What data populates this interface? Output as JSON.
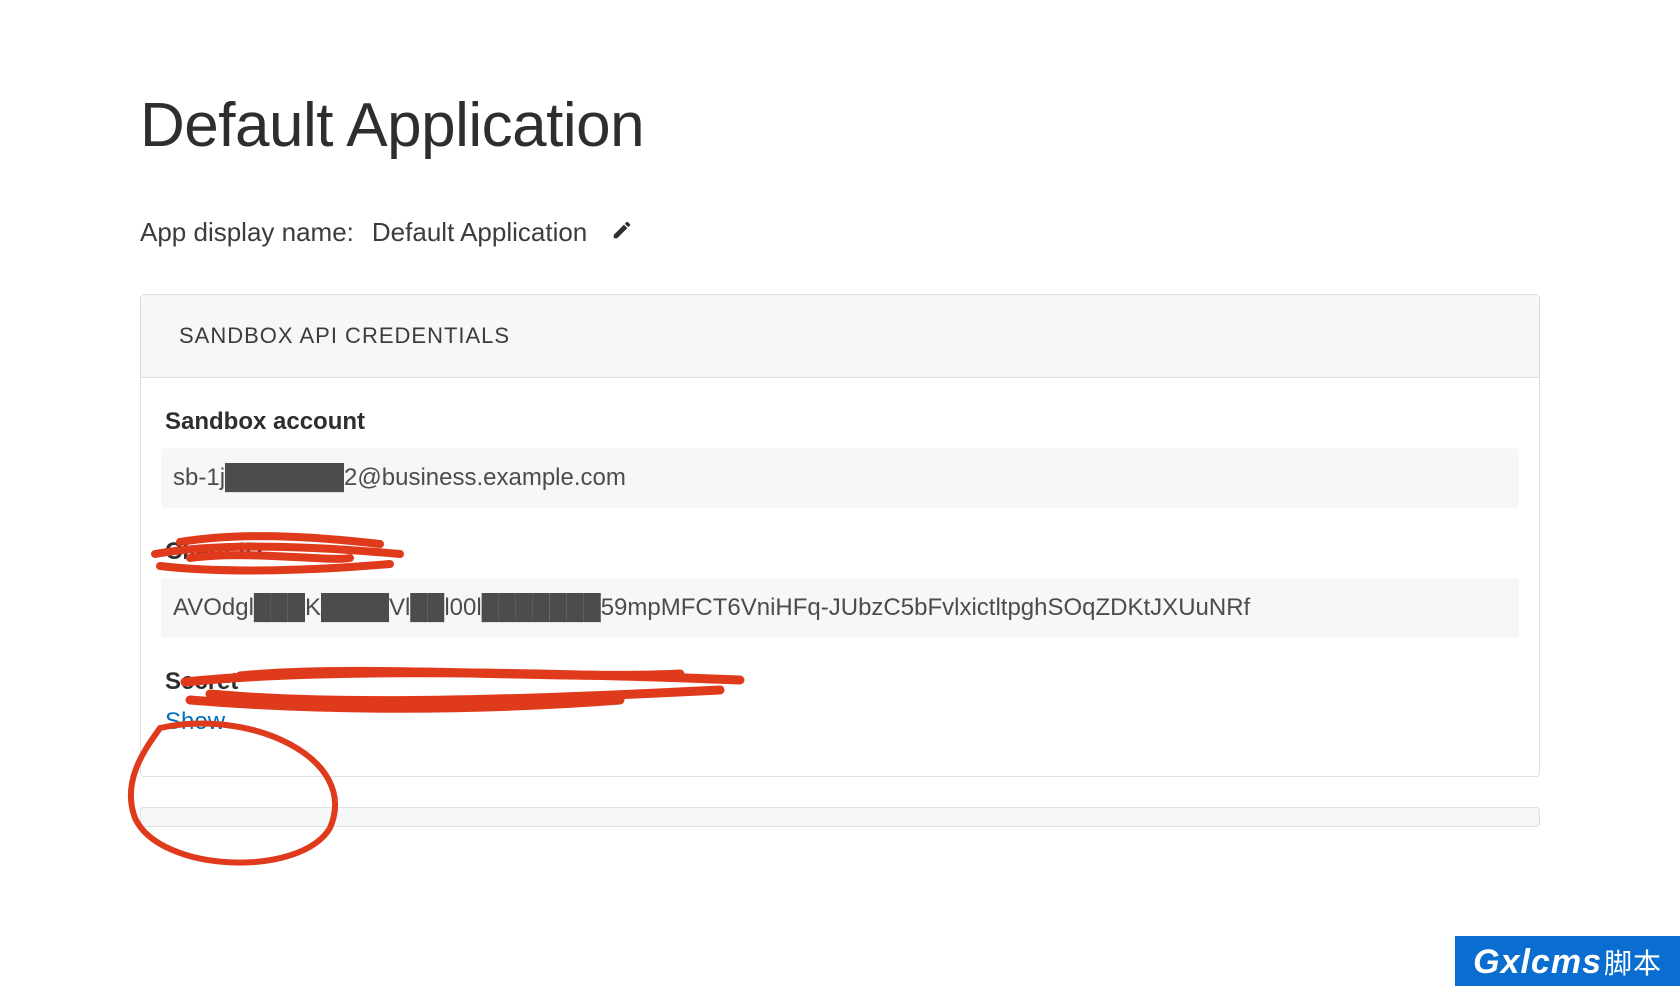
{
  "page": {
    "title": "Default Application"
  },
  "display_name": {
    "label": "App display name:",
    "value": "Default Application"
  },
  "credentials_panel": {
    "header": "SANDBOX API CREDENTIALS",
    "sandbox_account": {
      "label": "Sandbox account",
      "value": "sb-1j███████2@business.example.com"
    },
    "client_id": {
      "label": "Client ID",
      "value": "AVOdgl███K████Vl██l00l███████59mpMFCT6VniHFq-JUbzC5bFvlxictltpghSOqZDKtJXUuNRf"
    },
    "secret": {
      "label": "Secret",
      "show_link": "Show"
    }
  },
  "watermark": {
    "main": "Gxlcms",
    "sub": "脚本"
  }
}
